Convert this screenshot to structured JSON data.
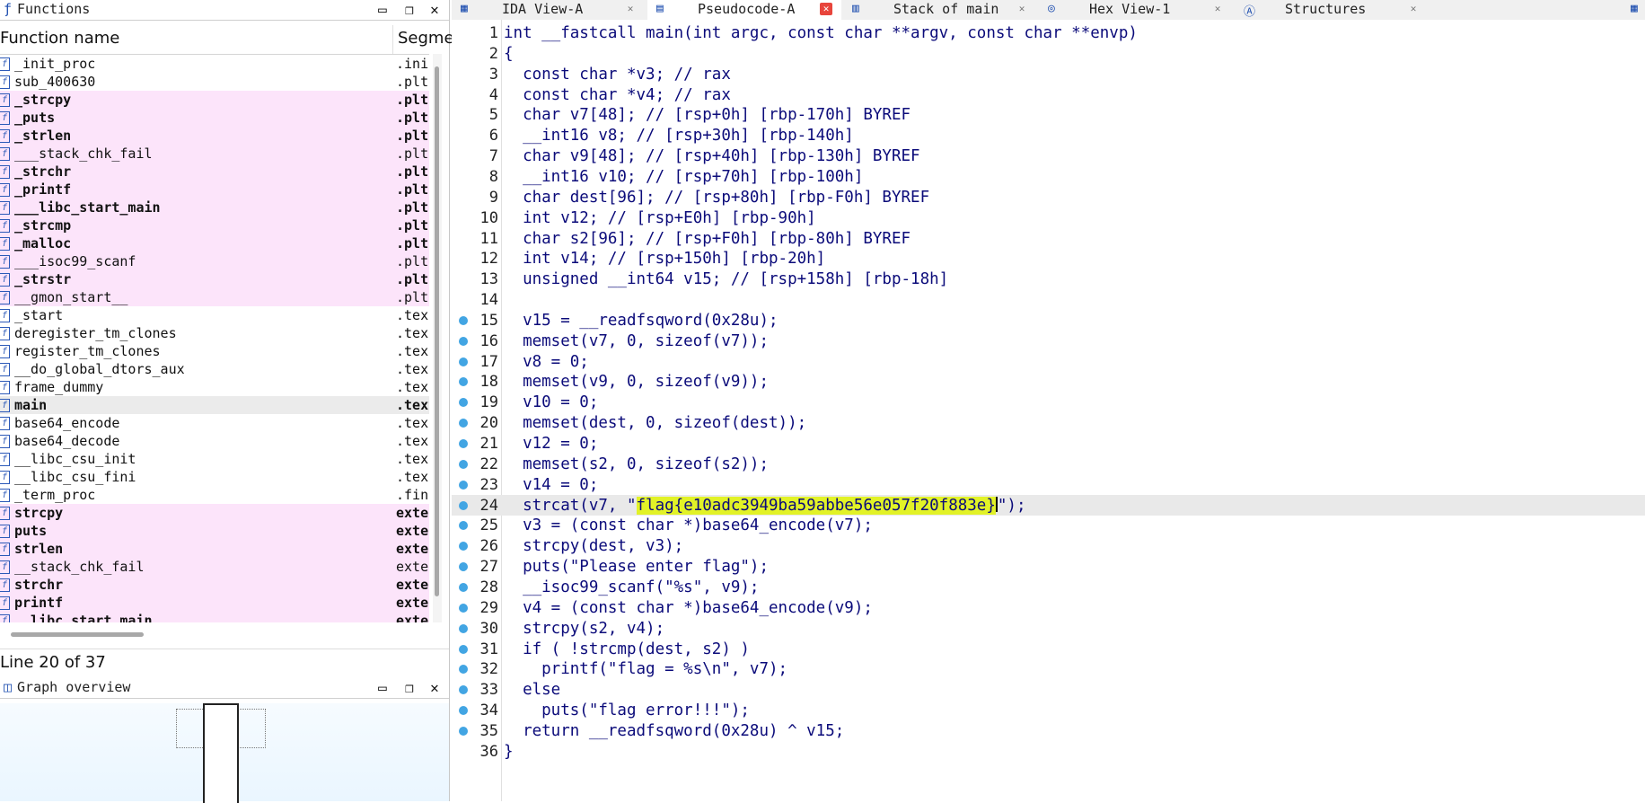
{
  "functions_panel": {
    "title": "Functions",
    "col_name": "Function name",
    "col_segment": "Segment",
    "items": [
      {
        "name": "_init_proc",
        "seg": ".init",
        "style": ""
      },
      {
        "name": "sub_400630",
        "seg": ".plt",
        "style": ""
      },
      {
        "name": "_strcpy",
        "seg": ".plt",
        "style": "pink bold"
      },
      {
        "name": "_puts",
        "seg": ".plt",
        "style": "pink bold"
      },
      {
        "name": "_strlen",
        "seg": ".plt",
        "style": "pink bold"
      },
      {
        "name": "___stack_chk_fail",
        "seg": ".plt",
        "style": "pink"
      },
      {
        "name": "_strchr",
        "seg": ".plt",
        "style": "pink bold"
      },
      {
        "name": "_printf",
        "seg": ".plt",
        "style": "pink bold"
      },
      {
        "name": "___libc_start_main",
        "seg": ".plt",
        "style": "pink bold"
      },
      {
        "name": "_strcmp",
        "seg": ".plt",
        "style": "pink bold"
      },
      {
        "name": "_malloc",
        "seg": ".plt",
        "style": "pink bold"
      },
      {
        "name": "___isoc99_scanf",
        "seg": ".plt",
        "style": "pink"
      },
      {
        "name": "_strstr",
        "seg": ".plt",
        "style": "pink bold"
      },
      {
        "name": "__gmon_start__",
        "seg": ".plt",
        "style": "pink"
      },
      {
        "name": "_start",
        "seg": ".text",
        "style": ""
      },
      {
        "name": "deregister_tm_clones",
        "seg": ".text",
        "style": ""
      },
      {
        "name": "register_tm_clones",
        "seg": ".text",
        "style": ""
      },
      {
        "name": "__do_global_dtors_aux",
        "seg": ".text",
        "style": ""
      },
      {
        "name": "frame_dummy",
        "seg": ".text",
        "style": ""
      },
      {
        "name": "main",
        "seg": ".text",
        "style": "sel bold"
      },
      {
        "name": "base64_encode",
        "seg": ".text",
        "style": ""
      },
      {
        "name": "base64_decode",
        "seg": ".text",
        "style": ""
      },
      {
        "name": "__libc_csu_init",
        "seg": ".text",
        "style": ""
      },
      {
        "name": "__libc_csu_fini",
        "seg": ".text",
        "style": ""
      },
      {
        "name": "_term_proc",
        "seg": ".fini",
        "style": ""
      },
      {
        "name": "strcpy",
        "seg": "extern",
        "style": "pink bold"
      },
      {
        "name": "puts",
        "seg": "extern",
        "style": "pink bold"
      },
      {
        "name": "strlen",
        "seg": "extern",
        "style": "pink bold"
      },
      {
        "name": "__stack_chk_fail",
        "seg": "extern",
        "style": "pink"
      },
      {
        "name": "strchr",
        "seg": "extern",
        "style": "pink bold"
      },
      {
        "name": "printf",
        "seg": "extern",
        "style": "pink bold"
      },
      {
        "name": "__libc_start_main",
        "seg": "extern",
        "style": "pink bold"
      }
    ]
  },
  "status": {
    "line_info": "Line 20 of 37"
  },
  "graph_overview": {
    "title": "Graph overview"
  },
  "tabs": [
    {
      "label": "IDA View-A",
      "icon": "ida-view-icon",
      "active": false
    },
    {
      "label": "Pseudocode-A",
      "icon": "pseudocode-icon",
      "active": true
    },
    {
      "label": "Stack of main",
      "icon": "stack-icon",
      "active": false
    },
    {
      "label": "Hex View-1",
      "icon": "hex-view-icon",
      "active": false
    },
    {
      "label": "Structures",
      "icon": "structures-icon",
      "active": false
    }
  ],
  "code": [
    {
      "n": 1,
      "bp": false,
      "t": "int __fastcall main(int argc, const char **argv, const char **envp)"
    },
    {
      "n": 2,
      "bp": false,
      "t": "{"
    },
    {
      "n": 3,
      "bp": false,
      "t": "  const char *v3; // rax"
    },
    {
      "n": 4,
      "bp": false,
      "t": "  const char *v4; // rax"
    },
    {
      "n": 5,
      "bp": false,
      "t": "  char v7[48]; // [rsp+0h] [rbp-170h] BYREF"
    },
    {
      "n": 6,
      "bp": false,
      "t": "  __int16 v8; // [rsp+30h] [rbp-140h]"
    },
    {
      "n": 7,
      "bp": false,
      "t": "  char v9[48]; // [rsp+40h] [rbp-130h] BYREF"
    },
    {
      "n": 8,
      "bp": false,
      "t": "  __int16 v10; // [rsp+70h] [rbp-100h]"
    },
    {
      "n": 9,
      "bp": false,
      "t": "  char dest[96]; // [rsp+80h] [rbp-F0h] BYREF"
    },
    {
      "n": 10,
      "bp": false,
      "t": "  int v12; // [rsp+E0h] [rbp-90h]"
    },
    {
      "n": 11,
      "bp": false,
      "t": "  char s2[96]; // [rsp+F0h] [rbp-80h] BYREF"
    },
    {
      "n": 12,
      "bp": false,
      "t": "  int v14; // [rsp+150h] [rbp-20h]"
    },
    {
      "n": 13,
      "bp": false,
      "t": "  unsigned __int64 v15; // [rsp+158h] [rbp-18h]"
    },
    {
      "n": 14,
      "bp": false,
      "t": ""
    },
    {
      "n": 15,
      "bp": true,
      "t": "  v15 = __readfsqword(0x28u);"
    },
    {
      "n": 16,
      "bp": true,
      "t": "  memset(v7, 0, sizeof(v7));"
    },
    {
      "n": 17,
      "bp": true,
      "t": "  v8 = 0;"
    },
    {
      "n": 18,
      "bp": true,
      "t": "  memset(v9, 0, sizeof(v9));"
    },
    {
      "n": 19,
      "bp": true,
      "t": "  v10 = 0;"
    },
    {
      "n": 20,
      "bp": true,
      "t": "  memset(dest, 0, sizeof(dest));"
    },
    {
      "n": 21,
      "bp": true,
      "t": "  v12 = 0;"
    },
    {
      "n": 22,
      "bp": true,
      "t": "  memset(s2, 0, sizeof(s2));"
    },
    {
      "n": 23,
      "bp": true,
      "t": "  v14 = 0;"
    },
    {
      "n": 24,
      "bp": true,
      "t": "  strcat(v7, \"flag{e10adc3949ba59abbe56e057f20f883e}\");",
      "pre": "  strcat(v7, \"",
      "flag": "flag{e10adc3949ba59abbe56e057f20f883e}",
      "post": "\");"
    },
    {
      "n": 25,
      "bp": true,
      "t": "  v3 = (const char *)base64_encode(v7);"
    },
    {
      "n": 26,
      "bp": true,
      "t": "  strcpy(dest, v3);"
    },
    {
      "n": 27,
      "bp": true,
      "t": "  puts(\"Please enter flag\");"
    },
    {
      "n": 28,
      "bp": true,
      "t": "  __isoc99_scanf(\"%s\", v9);"
    },
    {
      "n": 29,
      "bp": true,
      "t": "  v4 = (const char *)base64_encode(v9);"
    },
    {
      "n": 30,
      "bp": true,
      "t": "  strcpy(s2, v4);"
    },
    {
      "n": 31,
      "bp": true,
      "t": "  if ( !strcmp(dest, s2) )"
    },
    {
      "n": 32,
      "bp": true,
      "t": "    printf(\"flag = %s\\n\", v7);"
    },
    {
      "n": 33,
      "bp": true,
      "t": "  else"
    },
    {
      "n": 34,
      "bp": true,
      "t": "    puts(\"flag error!!!\");"
    },
    {
      "n": 35,
      "bp": true,
      "t": "  return __readfsqword(0x28u) ^ v15;"
    },
    {
      "n": 36,
      "bp": false,
      "t": "}"
    }
  ],
  "colors": {
    "flag_highlight": "#e2f227",
    "pink_rows": "#fce4fa",
    "breakpoint": "#42a5e3",
    "active_tab_close": "#e8453c"
  }
}
